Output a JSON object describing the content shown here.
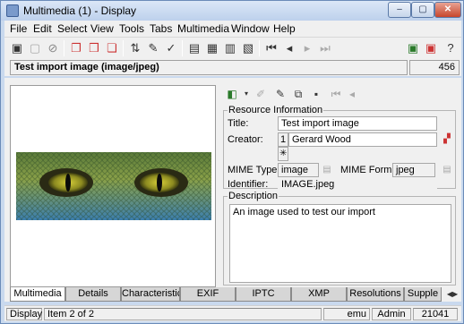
{
  "window": {
    "title": "Multimedia (1) - Display",
    "min_glyph": "–",
    "max_glyph": "▢",
    "close_glyph": "✕"
  },
  "menu": [
    "File",
    "Edit",
    "Select",
    "View",
    "Tools",
    "Tabs",
    "Multimedia",
    "Window",
    "Help"
  ],
  "record": {
    "title": "Test import image (image/jpeg)",
    "number": "456"
  },
  "resource_info": {
    "group_label": "Resource Information",
    "title_label": "Title:",
    "title_value": "Test import image",
    "creator_label": "Creator:",
    "creator_index": "1",
    "creator_value": "Gerard Wood",
    "creator_new_glyph": "✳",
    "mime_type_label": "MIME Type:",
    "mime_type_value": "image",
    "mime_format_label": "MIME Format:",
    "mime_format_value": "jpeg",
    "identifier_label": "Identifier:",
    "identifier_value": "IMAGE.jpeg"
  },
  "description": {
    "group_label": "Description",
    "text": "An image used to test our import"
  },
  "tabs": [
    "Multimedia",
    "Details",
    "Characteristics",
    "EXIF",
    "IPTC",
    "XMP",
    "Resolutions",
    "Supple"
  ],
  "tab_scroll": "◀▶",
  "status": {
    "mode": "Display",
    "item": "Item 2 of 2",
    "user": "emu",
    "role": "Admin",
    "count": "21041"
  },
  "colors": {
    "titlebar": "#c9d9ee",
    "close": "#c7452c"
  }
}
